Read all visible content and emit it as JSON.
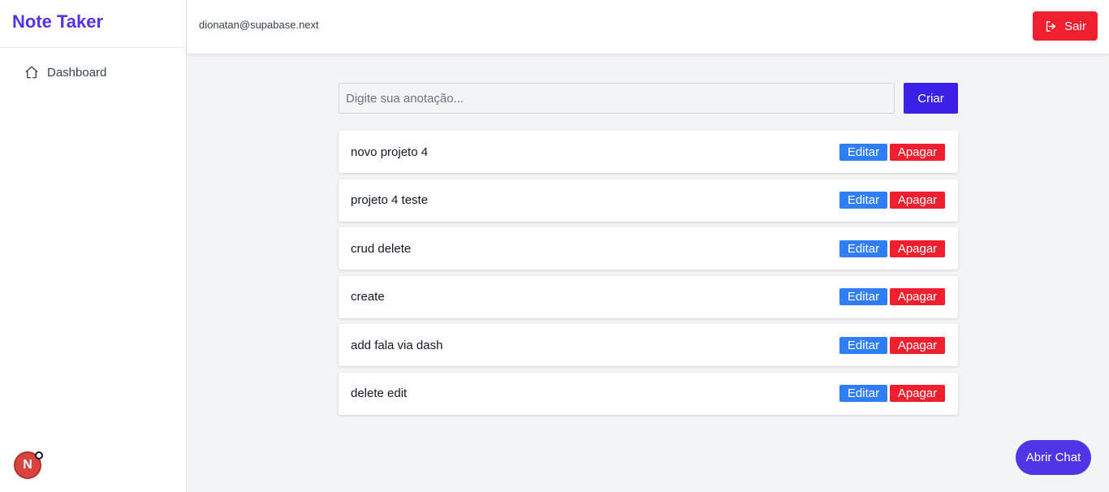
{
  "app": {
    "brand": "Note Taker"
  },
  "sidebar": {
    "items": [
      {
        "label": "Dashboard",
        "icon": "home-icon"
      }
    ]
  },
  "header": {
    "user_email": "dionatan@supabase.next",
    "logout_label": "Sair",
    "logout_icon": "logout-icon"
  },
  "composer": {
    "placeholder": "Digite sua anotação...",
    "value": "",
    "create_label": "Criar"
  },
  "notes": [
    {
      "text": "novo projeto 4",
      "edit_label": "Editar",
      "delete_label": "Apagar"
    },
    {
      "text": "projeto 4 teste",
      "edit_label": "Editar",
      "delete_label": "Apagar"
    },
    {
      "text": "crud delete",
      "edit_label": "Editar",
      "delete_label": "Apagar"
    },
    {
      "text": "create",
      "edit_label": "Editar",
      "delete_label": "Apagar"
    },
    {
      "text": "add fala via dash",
      "edit_label": "Editar",
      "delete_label": "Apagar"
    },
    {
      "text": "delete edit",
      "edit_label": "Editar",
      "delete_label": "Apagar"
    }
  ],
  "chat": {
    "label": "Abrir Chat"
  },
  "avatar": {
    "initial": "N"
  },
  "colors": {
    "brand": "#4f35e6",
    "primary": "#3b21e8",
    "edit": "#2f7ef6",
    "danger": "#ef1f2d",
    "background": "#f3f4f6"
  }
}
